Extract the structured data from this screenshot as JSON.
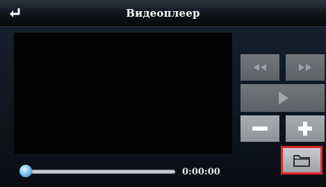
{
  "header": {
    "title": "Видеоплеер",
    "back_icon": "return-arrow-icon"
  },
  "video": {
    "state": "empty"
  },
  "controls": {
    "rewind_icon": "rewind-icon",
    "fast_forward_icon": "fast-forward-icon",
    "play_icon": "play-icon",
    "volume_down_icon": "minus-icon",
    "volume_up_icon": "plus-icon",
    "open_folder_icon": "folder-icon"
  },
  "playback": {
    "time": "0:00:00",
    "progress_fraction": 0.0
  },
  "colors": {
    "highlight_border": "#e3262a",
    "button_face": "#a0a4a9",
    "knob": "#7fc6ee"
  }
}
